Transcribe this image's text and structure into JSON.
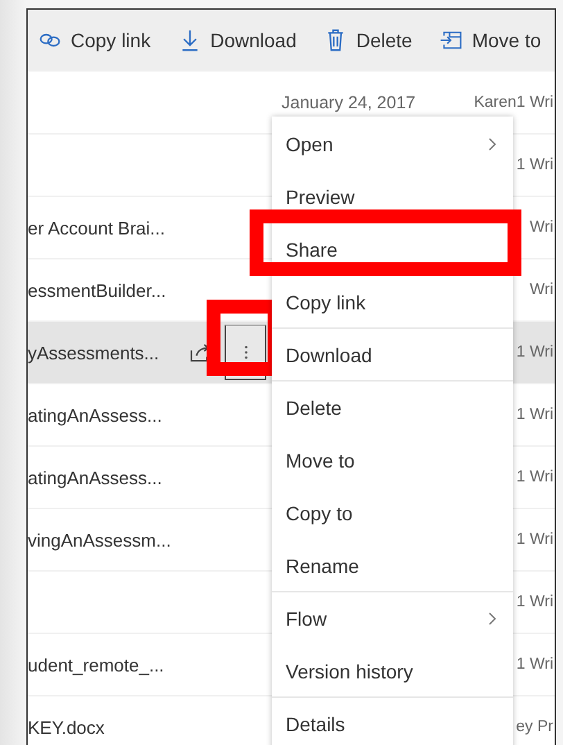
{
  "toolbar": [
    {
      "kind": "link",
      "label": "Copy link"
    },
    {
      "kind": "download",
      "label": "Download"
    },
    {
      "kind": "delete",
      "label": "Delete"
    },
    {
      "kind": "move",
      "label": "Move to"
    }
  ],
  "rows": [
    {
      "name": "",
      "date": "January 24, 2017",
      "author": "Karen1 Wri",
      "selected": false
    },
    {
      "name": "",
      "date": "",
      "author": "1 Wri",
      "selected": false
    },
    {
      "name": "er Account Brai...",
      "date": "",
      "author": "Wri",
      "selected": false
    },
    {
      "name": "essmentBuilder...",
      "date": "",
      "author": "Wri",
      "selected": false
    },
    {
      "name": "yAssessments...",
      "date": "",
      "author": "1 Wri",
      "selected": true,
      "more_highlighted": true
    },
    {
      "name": "atingAnAssess...",
      "date": "",
      "author": "1 Wri",
      "selected": false
    },
    {
      "name": "atingAnAssess...",
      "date": "",
      "author": "1 Wri",
      "selected": false
    },
    {
      "name": "vingAnAssessm...",
      "date": "",
      "author": "1 Wri",
      "selected": false
    },
    {
      "name": "",
      "date": "",
      "author": "1 Wri",
      "selected": false
    },
    {
      "name": "udent_remote_...",
      "date": "",
      "author": "1 Wri",
      "selected": false
    },
    {
      "name": "KEY.docx",
      "date": "",
      "author": "ey Pr",
      "selected": false
    }
  ],
  "context_menu": [
    {
      "label": "Open",
      "submenu": true,
      "highlighted": false,
      "divider_after": false
    },
    {
      "label": "Preview",
      "submenu": false,
      "highlighted": false,
      "divider_after": false
    },
    {
      "label": "Share",
      "submenu": false,
      "highlighted": true,
      "divider_after": false
    },
    {
      "label": "Copy link",
      "submenu": false,
      "highlighted": false,
      "divider_after": true
    },
    {
      "label": "Download",
      "submenu": false,
      "highlighted": false,
      "divider_after": true
    },
    {
      "label": "Delete",
      "submenu": false,
      "highlighted": false,
      "divider_after": false
    },
    {
      "label": "Move to",
      "submenu": false,
      "highlighted": false,
      "divider_after": false
    },
    {
      "label": "Copy to",
      "submenu": false,
      "highlighted": false,
      "divider_after": false
    },
    {
      "label": "Rename",
      "submenu": false,
      "highlighted": false,
      "divider_after": true
    },
    {
      "label": "Flow",
      "submenu": true,
      "highlighted": false,
      "divider_after": false
    },
    {
      "label": "Version history",
      "submenu": false,
      "highlighted": false,
      "divider_after": true
    },
    {
      "label": "Details",
      "submenu": false,
      "highlighted": false
    }
  ]
}
